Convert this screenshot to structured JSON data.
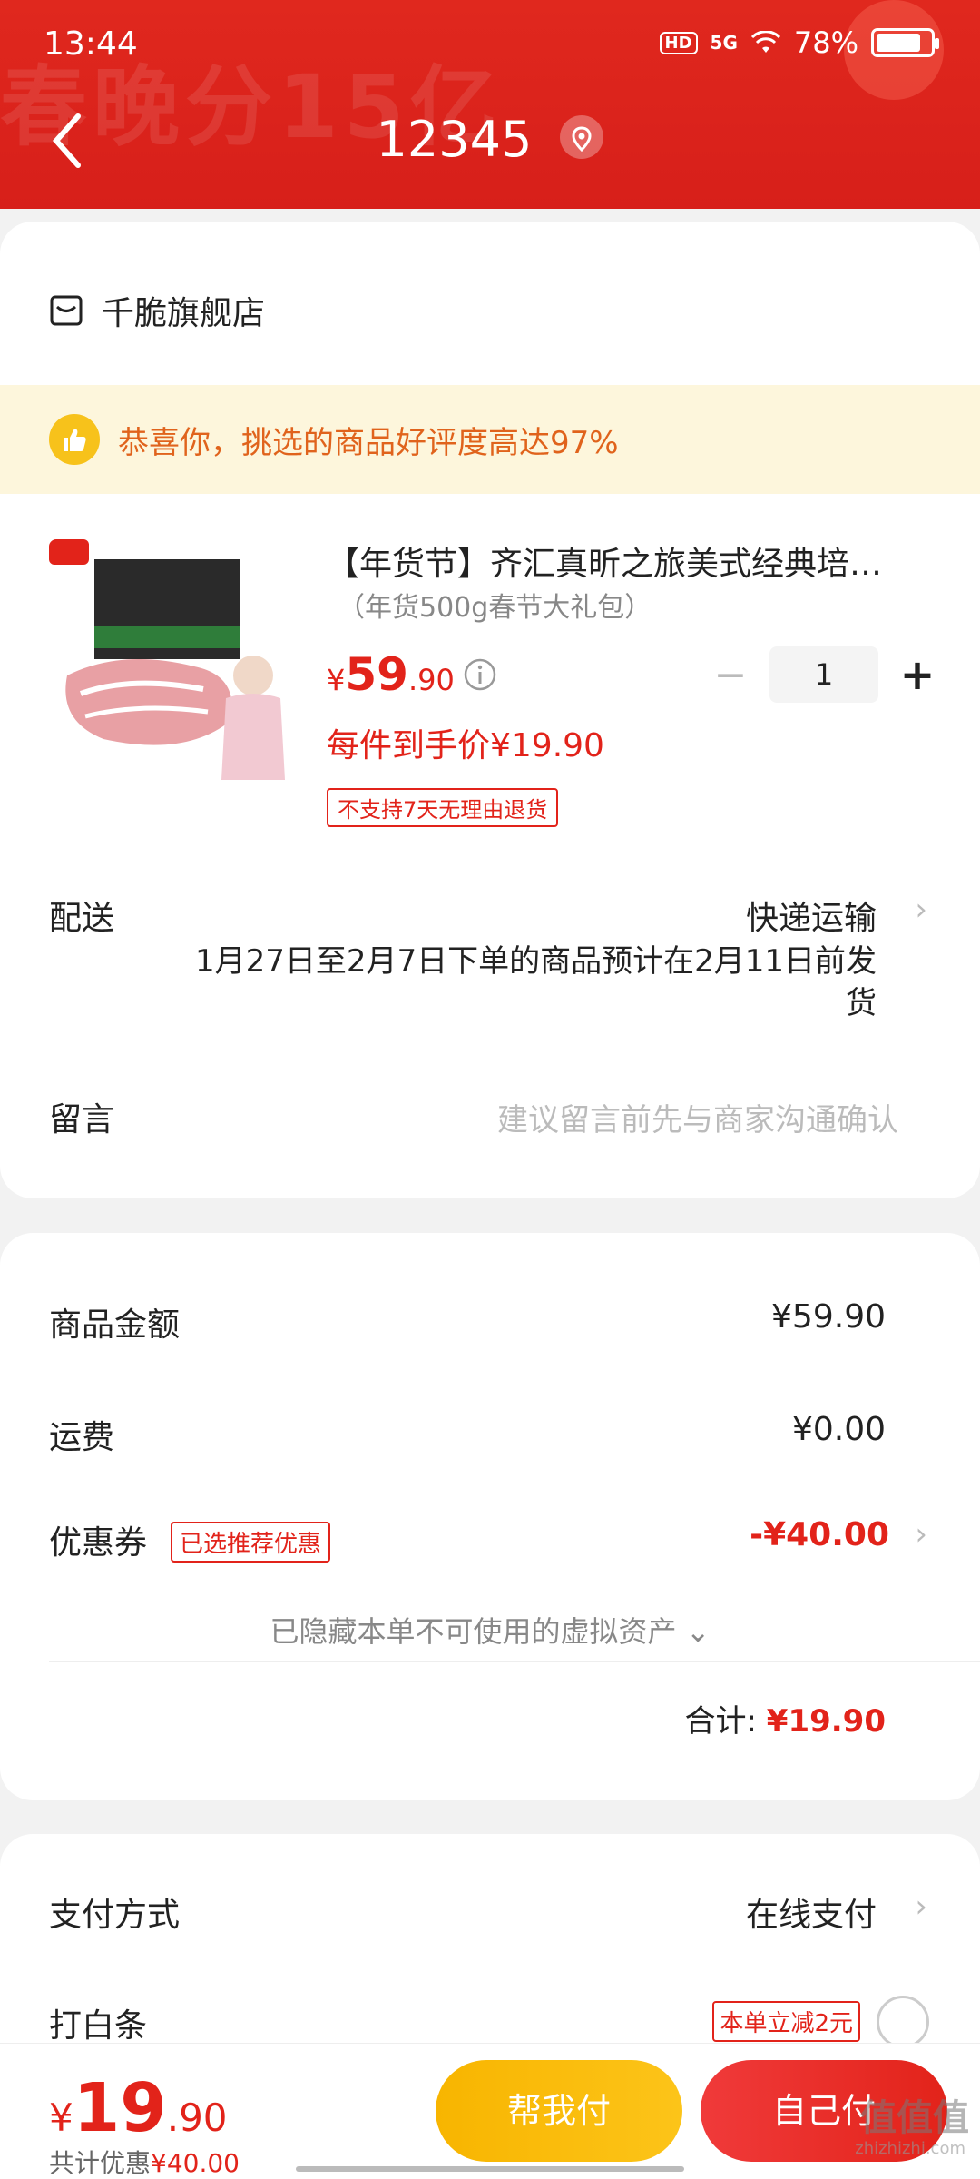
{
  "status_bar": {
    "time": "13:44",
    "hd": "HD",
    "network": "5G",
    "battery": "78%"
  },
  "header": {
    "deco_text": "春晚分15亿",
    "title": "12345"
  },
  "shop": {
    "name": "千脆旗舰店"
  },
  "banner": {
    "text": "恭喜你，挑选的商品好评度高达97%"
  },
  "product": {
    "title": "【年货节】齐汇真昕之旅美式经典培…",
    "sku": "（年货500g春节大礼包）",
    "price_yen": "¥",
    "price_int": "59",
    "price_dec": ".90",
    "final_price": "每件到手价¥19.90",
    "no_return": "不支持7天无理由退货",
    "quantity": "1",
    "minus": "−",
    "plus": "+"
  },
  "delivery": {
    "label": "配送",
    "value": "快递运输",
    "note": "1月27日至2月7日下单的商品预计在2月11日前发货"
  },
  "message": {
    "label": "留言",
    "placeholder": "建议留言前先与商家沟通确认"
  },
  "summary": {
    "goods_label": "商品金额",
    "goods_value": "¥59.90",
    "shipping_label": "运费",
    "shipping_value": "¥0.00",
    "coupon_label": "优惠券",
    "coupon_tag": "已选推荐优惠",
    "coupon_value": "-¥40.00",
    "hidden_assets": "已隐藏本单不可使用的虚拟资产",
    "total_label": "合计:",
    "total_value": "¥19.90"
  },
  "payment": {
    "method_label": "支付方式",
    "method_value": "在线支付",
    "baitiao_label": "打白条",
    "baitiao_tag": "本单立减2元"
  },
  "bottom_bar": {
    "price_yen": "¥",
    "price_int": "19",
    "price_dec": ".90",
    "discount_label": "共计优惠",
    "discount_value": "¥40.00",
    "help_pay": "帮我付",
    "self_pay": "自己付"
  },
  "watermark": {
    "text": "值值值",
    "sub": "zhizhizhi.com"
  },
  "colors": {
    "brand_red": "#e2231a",
    "header_red": "#d71f1a",
    "banner_bg": "#fdf6dc",
    "banner_text": "#e0631c",
    "help_button": "#f8b500"
  }
}
